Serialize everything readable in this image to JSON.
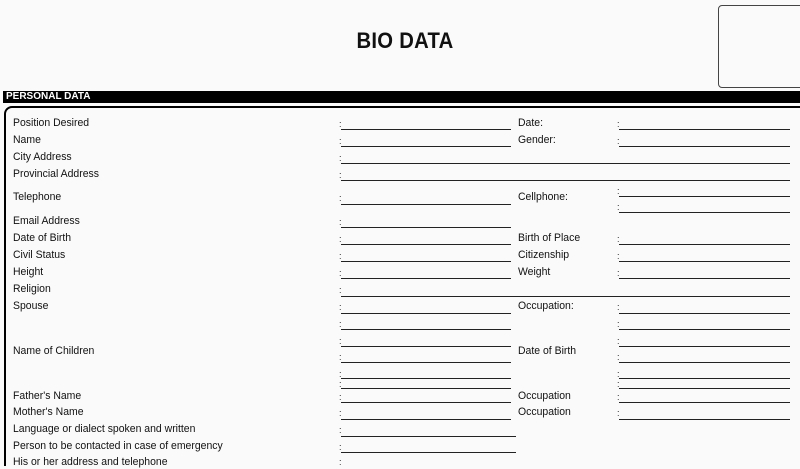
{
  "form": {
    "title": "BIO DATA",
    "section": "PERSONAL DATA",
    "colon": ":",
    "labels": {
      "position_desired": "Position Desired",
      "date": "Date:",
      "name": "Name",
      "gender": "Gender:",
      "city_address": "City Address",
      "provincial_address": "Provincial Address",
      "telephone": "Telephone",
      "cellphone": "Cellphone:",
      "email_address": "Email Address",
      "date_of_birth": "Date of Birth",
      "birth_of_place": "Birth of Place",
      "civil_status": "Civil Status",
      "citizenship": "Citizenship",
      "height": "Height",
      "weight": "Weight",
      "religion": "Religion",
      "spouse": "Spouse",
      "occupation": "Occupation:",
      "name_of_children": "Name of Children",
      "children_date_of_birth": "Date of Birth",
      "fathers_name": "Father's Name",
      "fathers_occupation": "Occupation",
      "mothers_name": "Mother's Name",
      "mothers_occupation": "Occupation",
      "language": "Language or dialect spoken and written",
      "emergency_contact": "Person to be contacted in case of emergency",
      "his_her_address": "His or her address and telephone"
    }
  }
}
